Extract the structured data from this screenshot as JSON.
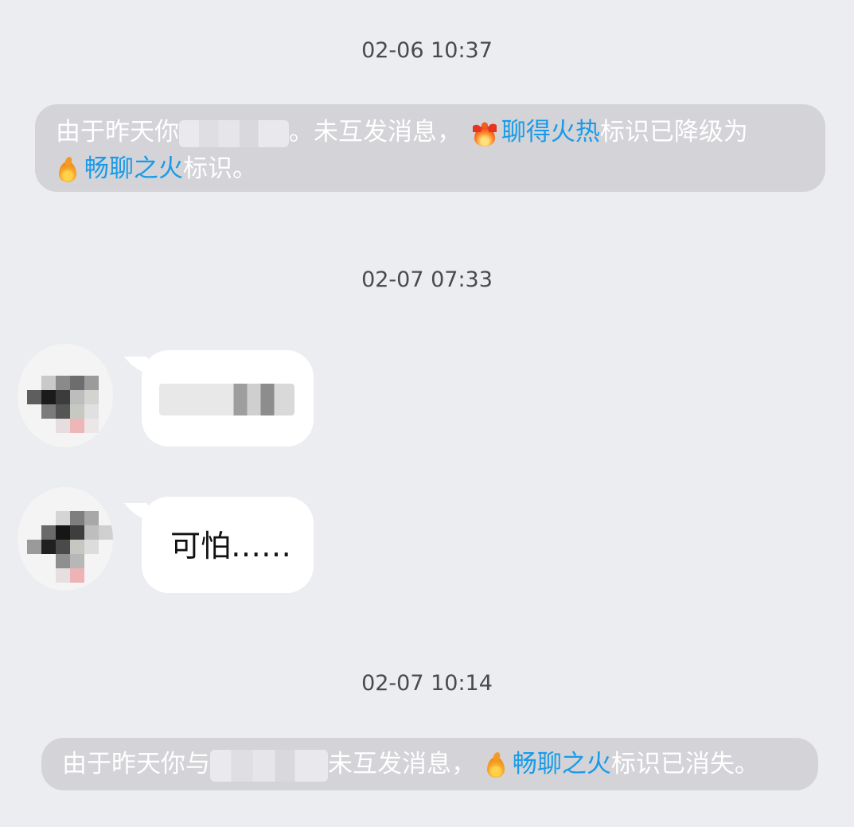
{
  "timestamps": {
    "t1": "02-06 10:37",
    "t2": "02-07 07:33",
    "t3": "02-07 10:14"
  },
  "system_messages": [
    {
      "line1_prefix": "由于昨天你",
      "line1_middle": "。未互发消息，",
      "line1_link": "聊得火热",
      "line1_suffix": "标识已降级为",
      "line2_link": "畅聊之火",
      "line2_suffix": "标识。",
      "icons": [
        "hot-chat-flame-icon",
        "chat-flame-icon"
      ]
    },
    {
      "prefix": "由于昨天你与",
      "middle": "未互发消息，",
      "link": "畅聊之火",
      "suffix": "标识已消失。",
      "icons": [
        "chat-flame-icon"
      ]
    }
  ],
  "messages": [
    {
      "sender": "contact",
      "text": "",
      "redacted": true
    },
    {
      "sender": "contact",
      "text": "可怕……",
      "redacted": false
    }
  ],
  "colors": {
    "background": "#ecedf1",
    "system_bubble": "#d3d3d8",
    "link": "#1a9be8",
    "bubble": "#ffffff"
  }
}
